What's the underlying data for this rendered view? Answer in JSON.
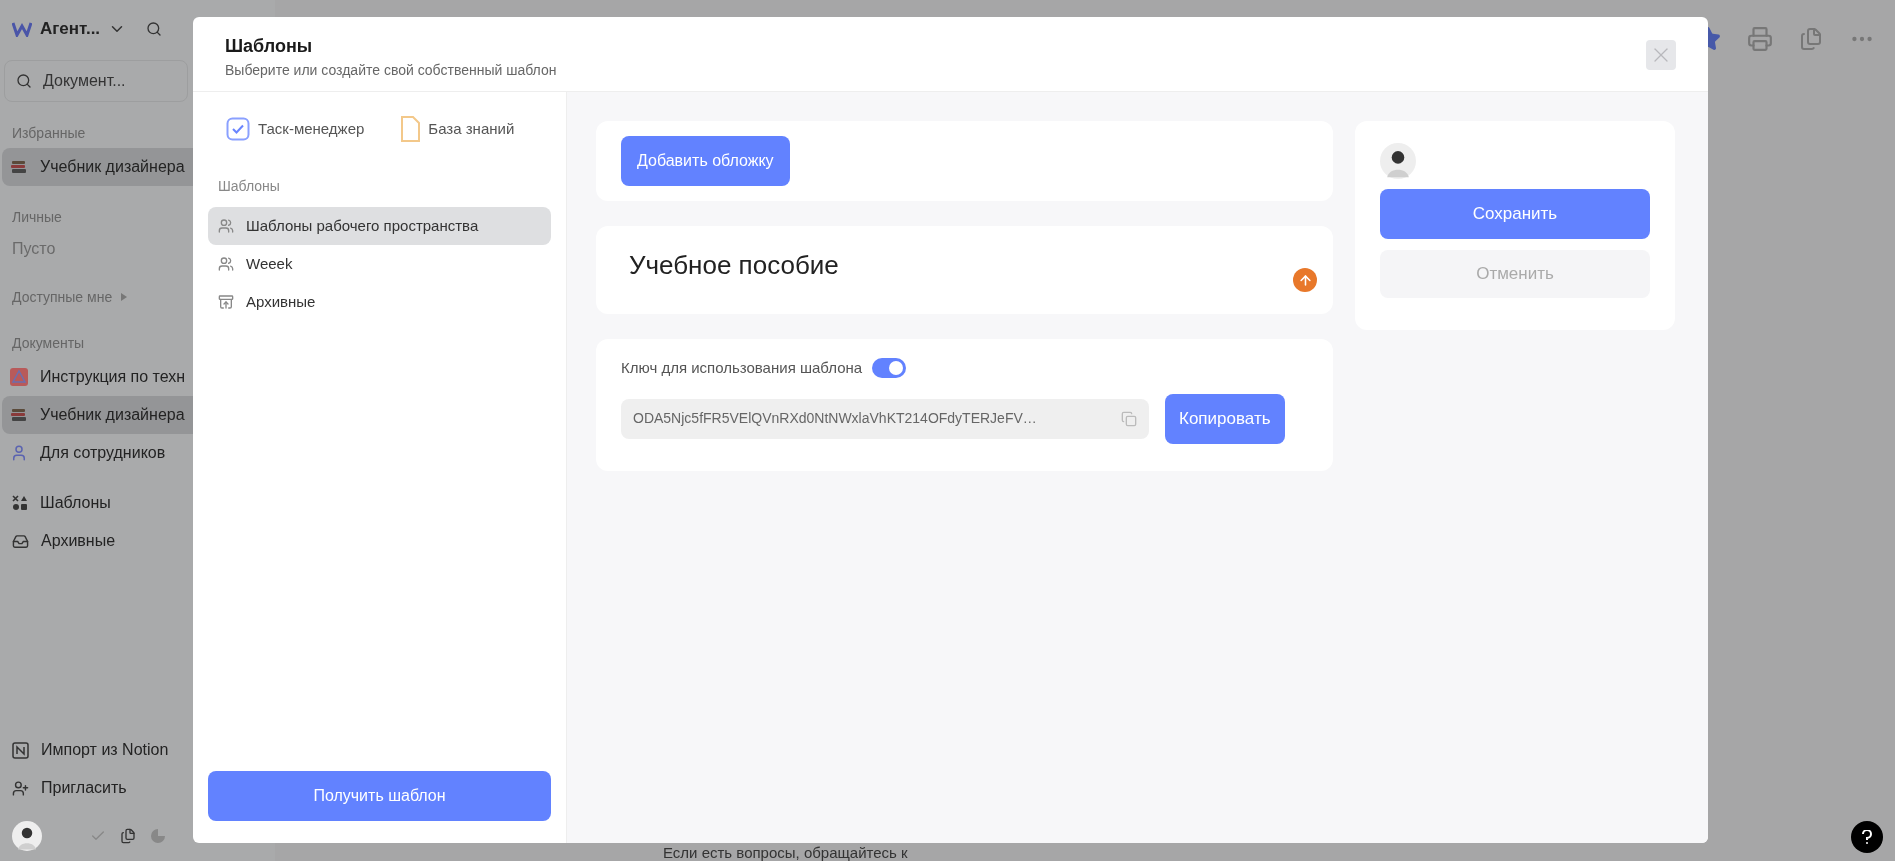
{
  "sidebar": {
    "workspace": "Агент...",
    "search": {
      "placeholder": "Документ..."
    },
    "sections": [
      {
        "title": "Избранные",
        "items": [
          {
            "label": "Учебник дизайнера",
            "selected": true
          }
        ]
      },
      {
        "title": "Личные",
        "empty_text": "Пусто"
      },
      {
        "title": "Доступные мне",
        "expanded": false
      },
      {
        "title": "Документы",
        "items": [
          {
            "label": "Инструкция по техн",
            "selected": false
          },
          {
            "label": "Учебник дизайнера",
            "selected": true
          },
          {
            "label": "Для сотрудников",
            "selected": false
          }
        ]
      }
    ],
    "links": [
      {
        "label": "Шаблоны"
      },
      {
        "label": "Архивные"
      }
    ],
    "footer_links": [
      {
        "label": "Импорт из Notion"
      },
      {
        "label": "Пригласить"
      }
    ]
  },
  "page": {
    "footer_text": "Если есть вопросы, обращайтесь к"
  },
  "modal": {
    "title": "Шаблоны",
    "subtitle": "Выберите или создайте свой собственный шаблон",
    "categories": [
      {
        "label": "Таск-менеджер"
      },
      {
        "label": "База знаний"
      }
    ],
    "list_title": "Шаблоны",
    "list": [
      {
        "label": "Шаблоны рабочего пространства",
        "selected": true
      },
      {
        "label": "Weeek",
        "selected": false
      },
      {
        "label": "Архивные",
        "selected": false
      }
    ],
    "get_button": "Получить шаблон",
    "cover_button": "Добавить обложку",
    "doc_title": "Учебное пособие",
    "key": {
      "label": "Ключ для использования шаблона",
      "on": true,
      "value": "ODA5Njc5fFR5VElQVnRXd0NtNWxlaVhKT214OFdyTERJeFV…",
      "copy_button": "Копировать"
    },
    "save_button": "Сохранить",
    "cancel_button": {
      "label": "Отменить",
      "disabled": true
    }
  }
}
